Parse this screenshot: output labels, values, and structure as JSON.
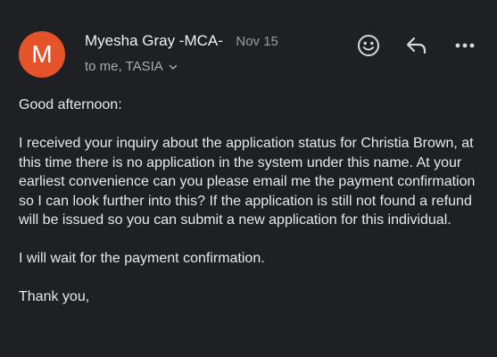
{
  "header": {
    "avatar_letter": "M",
    "sender_name": "Myesha Gray -MCA-",
    "date": "Nov 15",
    "recipients": "to me, TASIA"
  },
  "icons": {
    "emoji": "smiley-icon",
    "reply": "reply-icon",
    "more": "more-icon",
    "details": "chevron-down-icon"
  },
  "colors": {
    "background": "#1f2023",
    "avatar": "#e4532a"
  },
  "message": {
    "greeting": "Good afternoon:",
    "paragraph1": "I received your inquiry about the application status for Christia Brown, at this time there is no application in the system under this name. At your earliest convenience can you please email me the payment confirmation so I can look further into this? If the application is still not found a refund will be issued so you can submit a new application for this individual.",
    "paragraph2": "I will wait for the payment confirmation.",
    "closing": "Thank you,"
  }
}
